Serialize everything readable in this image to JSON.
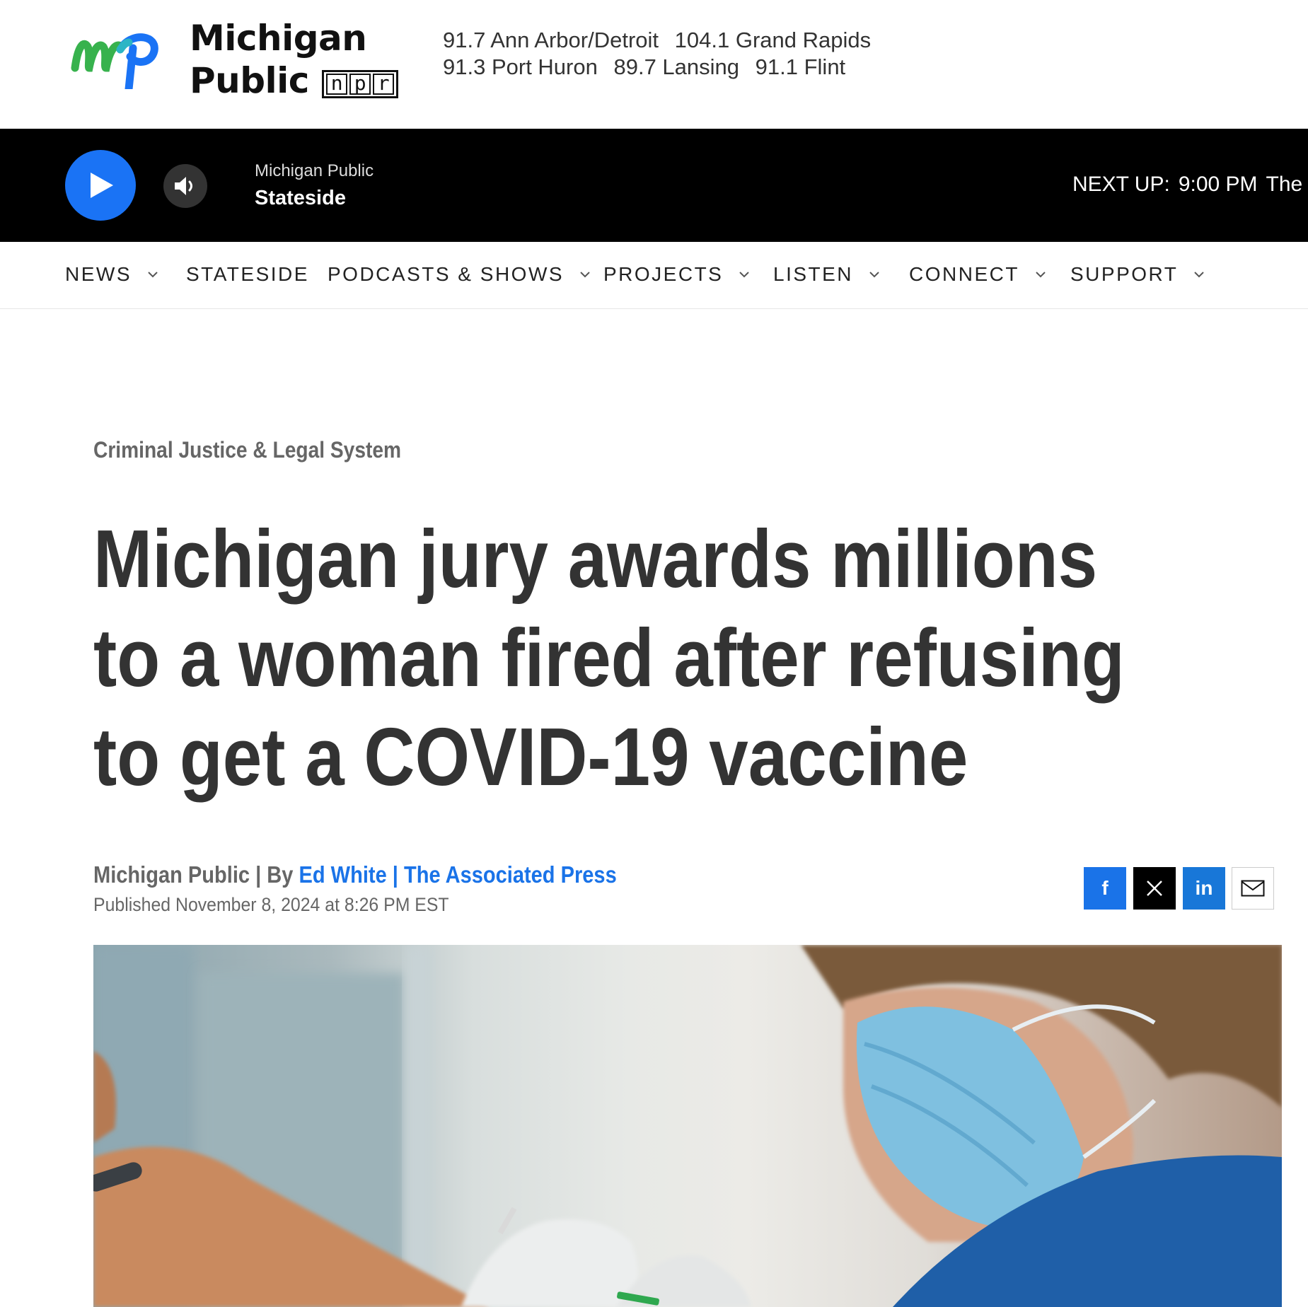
{
  "header": {
    "logo_alt": "Michigan Public NPR",
    "logo_line1": "Michigan",
    "logo_line2": "Public",
    "npr_letters": [
      "n",
      "p",
      "r"
    ],
    "stations_line1": [
      "91.7 Ann Arbor/Detroit",
      "104.1 Grand Rapids"
    ],
    "stations_line2": [
      "91.3 Port Huron",
      "89.7 Lansing",
      "91.1 Flint"
    ]
  },
  "player": {
    "station": "Michigan Public",
    "show": "Stateside",
    "next_label": "NEXT UP:",
    "next_time": "9:00 PM",
    "next_show": "The M",
    "play_color": "#1a73f5"
  },
  "nav": {
    "items": [
      {
        "label": "NEWS",
        "dropdown": true
      },
      {
        "label": "STATESIDE",
        "dropdown": false
      },
      {
        "label": "PODCASTS & SHOWS",
        "dropdown": true
      },
      {
        "label": "PROJECTS",
        "dropdown": true
      },
      {
        "label": "LISTEN",
        "dropdown": true
      },
      {
        "label": "CONNECT",
        "dropdown": true
      },
      {
        "label": "SUPPORT",
        "dropdown": true
      }
    ]
  },
  "article": {
    "category": "Criminal Justice & Legal System",
    "headline": "Michigan jury awards millions to a woman fired after refusing to get a COVID-19 vaccine",
    "byline_source": "Michigan Public | By",
    "byline_author": "Ed White | The Associated Press",
    "published": "Published November 8, 2024 at 8:26 PM EST",
    "link_color": "#1a73e8"
  },
  "share": {
    "facebook_icon": "facebook-icon",
    "x_icon": "x-icon",
    "linkedin_icon": "linkedin-icon",
    "linkedin_text": "in",
    "facebook_text": "f",
    "email_icon": "mail-icon"
  }
}
